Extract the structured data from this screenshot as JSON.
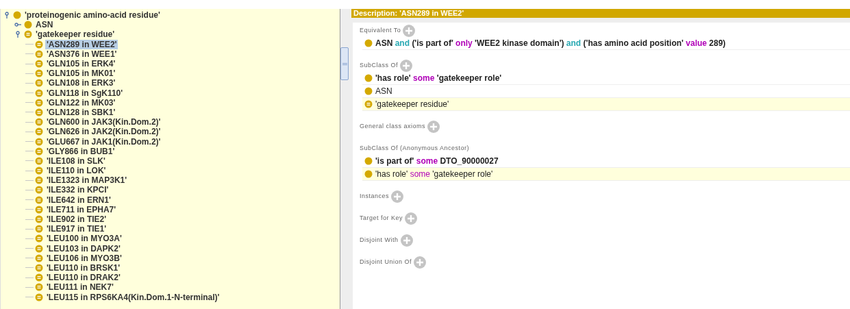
{
  "class_tree": {
    "items": [
      {
        "label": "'proteinogenic amino-acid residue'",
        "kind": "class",
        "expanded": true,
        "selected": false,
        "children": [
          {
            "label": "ASN",
            "kind": "class",
            "expanded": false,
            "selected": false
          },
          {
            "label": "'gatekeeper residue'",
            "kind": "defined",
            "expanded": true,
            "selected": false,
            "children": [
              {
                "label": "'ASN289 in WEE2'",
                "kind": "defined",
                "selected": true
              },
              {
                "label": "'ASN376 in WEE1'",
                "kind": "defined",
                "selected": false
              },
              {
                "label": "'GLN105 in ERK4'",
                "kind": "defined",
                "selected": false
              },
              {
                "label": "'GLN105 in MK01'",
                "kind": "defined",
                "selected": false
              },
              {
                "label": "'GLN108 in ERK3'",
                "kind": "defined",
                "selected": false
              },
              {
                "label": "'GLN118 in SgK110'",
                "kind": "defined",
                "selected": false
              },
              {
                "label": "'GLN122 in MK03'",
                "kind": "defined",
                "selected": false
              },
              {
                "label": "'GLN128 in SBK1'",
                "kind": "defined",
                "selected": false
              },
              {
                "label": "'GLN600 in JAK3(Kin.Dom.2)'",
                "kind": "defined",
                "selected": false
              },
              {
                "label": "'GLN626 in JAK2(Kin.Dom.2)'",
                "kind": "defined",
                "selected": false
              },
              {
                "label": "'GLU667 in JAK1(Kin.Dom.2)'",
                "kind": "defined",
                "selected": false
              },
              {
                "label": "'GLY866 in BUB1'",
                "kind": "defined",
                "selected": false
              },
              {
                "label": "'ILE108 in SLK'",
                "kind": "defined",
                "selected": false
              },
              {
                "label": "'ILE110 in LOK'",
                "kind": "defined",
                "selected": false
              },
              {
                "label": "'ILE1323 in MAP3K1'",
                "kind": "defined",
                "selected": false
              },
              {
                "label": "'ILE332 in KPCI'",
                "kind": "defined",
                "selected": false
              },
              {
                "label": "'ILE642 in ERN1'",
                "kind": "defined",
                "selected": false
              },
              {
                "label": "'ILE711 in EPHA7'",
                "kind": "defined",
                "selected": false
              },
              {
                "label": "'ILE902 in TIE2'",
                "kind": "defined",
                "selected": false
              },
              {
                "label": "'ILE917 in TIE1'",
                "kind": "defined",
                "selected": false
              },
              {
                "label": "'LEU100 in MYO3A'",
                "kind": "defined",
                "selected": false
              },
              {
                "label": "'LEU103 in DAPK2'",
                "kind": "defined",
                "selected": false
              },
              {
                "label": "'LEU106 in MYO3B'",
                "kind": "defined",
                "selected": false
              },
              {
                "label": "'LEU110 in BRSK1'",
                "kind": "defined",
                "selected": false
              },
              {
                "label": "'LEU110 in DRAK2'",
                "kind": "defined",
                "selected": false
              },
              {
                "label": "'LEU111 in NEK7'",
                "kind": "defined",
                "selected": false
              },
              {
                "label": "'LEU115 in RPS6KA4(Kin.Dom.1-N-terminal)'",
                "kind": "defined",
                "selected": false
              }
            ]
          }
        ]
      }
    ]
  },
  "description": {
    "title": "Description: 'ASN289 in WEE2'",
    "sections": [
      {
        "title": "Equivalent To",
        "addable": true,
        "items": [
          {
            "kind": "class",
            "inferred": false,
            "bold": true,
            "tokens": [
              {
                "t": "ASN",
                "kind": "name"
              },
              {
                "t": "and",
                "kind": "logic"
              },
              {
                "t": "('is part of'",
                "kind": "name"
              },
              {
                "t": "only",
                "kind": "restriction"
              },
              {
                "t": "'WEE2 kinase domain')",
                "kind": "name"
              },
              {
                "t": "and",
                "kind": "logic"
              },
              {
                "t": "('has amino acid position'",
                "kind": "name"
              },
              {
                "t": "value",
                "kind": "restriction"
              },
              {
                "t": "289)",
                "kind": "name"
              }
            ]
          }
        ]
      },
      {
        "title": "SubClass Of",
        "addable": true,
        "items": [
          {
            "kind": "class",
            "inferred": false,
            "bold": true,
            "tokens": [
              {
                "t": "'has role'",
                "kind": "name"
              },
              {
                "t": "some",
                "kind": "restriction"
              },
              {
                "t": "'gatekeeper role'",
                "kind": "name"
              }
            ]
          },
          {
            "kind": "class",
            "inferred": false,
            "bold": false,
            "tokens": [
              {
                "t": "ASN",
                "kind": "name"
              }
            ]
          },
          {
            "kind": "defined",
            "inferred": true,
            "bold": false,
            "tokens": [
              {
                "t": "'gatekeeper residue'",
                "kind": "name"
              }
            ]
          }
        ]
      },
      {
        "title": "General class axioms",
        "addable": true
      },
      {
        "title": "SubClass Of (Anonymous Ancestor)",
        "items": [
          {
            "kind": "class",
            "inferred": false,
            "bold": true,
            "tokens": [
              {
                "t": "'is part of'",
                "kind": "name"
              },
              {
                "t": "some",
                "kind": "restriction"
              },
              {
                "t": "DTO_90000027",
                "kind": "name"
              }
            ]
          },
          {
            "kind": "class",
            "inferred": true,
            "bold": false,
            "tokens": [
              {
                "t": "'has role'",
                "kind": "name"
              },
              {
                "t": "some",
                "kind": "restriction"
              },
              {
                "t": "'gatekeeper role'",
                "kind": "name"
              }
            ]
          }
        ]
      },
      {
        "title": "Instances",
        "addable": true
      },
      {
        "title": "Target for Key",
        "addable": true
      },
      {
        "title": "Disjoint With",
        "addable": true
      },
      {
        "title": "Disjoint Union Of",
        "addable": true
      }
    ]
  }
}
